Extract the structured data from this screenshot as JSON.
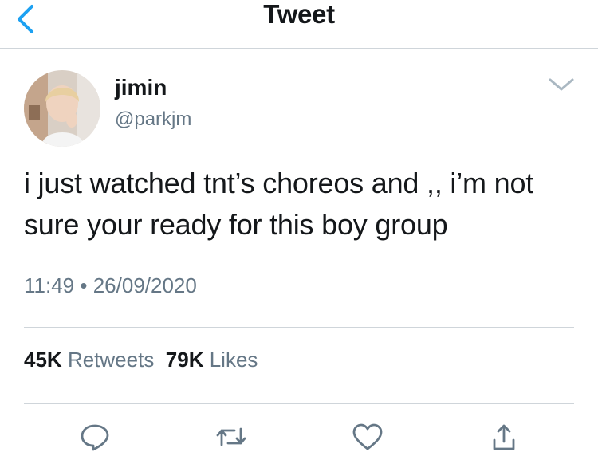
{
  "header": {
    "title": "Tweet",
    "back_icon": "chevron-left-icon",
    "accent": "#1da1f2"
  },
  "tweet": {
    "author_name": "jimin",
    "author_handle": "@parkjm",
    "text": "i just watched tnt’s choreos and ,, i’m not sure your ready for this boy group",
    "time": "11:49",
    "separator": "•",
    "date": "26/09/2020",
    "retweets_count": "45K",
    "retweets_label": "Retweets",
    "likes_count": "79K",
    "likes_label": "Likes"
  },
  "actions": [
    {
      "name": "reply",
      "icon": "speech-bubble-icon"
    },
    {
      "name": "retweet",
      "icon": "retweet-arrows-icon"
    },
    {
      "name": "like",
      "icon": "heart-icon"
    },
    {
      "name": "share",
      "icon": "share-upload-icon"
    }
  ],
  "colors": {
    "text": "#14171a",
    "secondary": "#657786",
    "divider": "#cfd5da",
    "accent": "#1da1f2"
  }
}
